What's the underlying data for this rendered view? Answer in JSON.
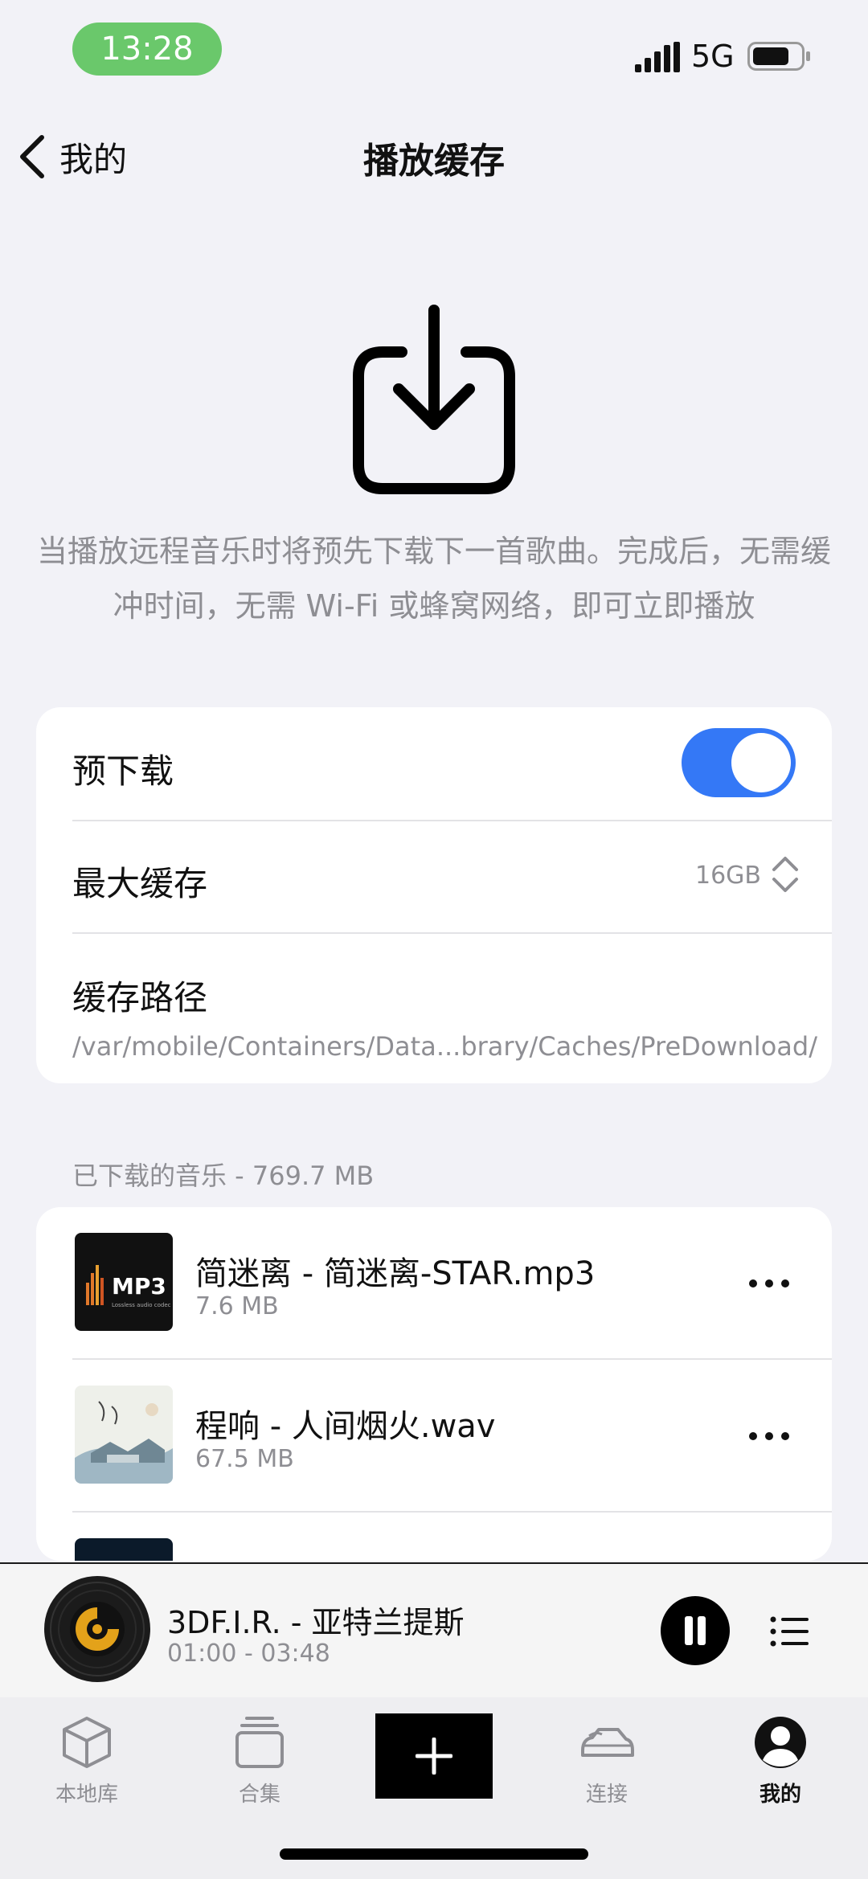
{
  "status_bar": {
    "time": "13:28",
    "network": "5G"
  },
  "nav": {
    "back_label": "我的",
    "title": "播放缓存"
  },
  "hero": {
    "icon": "download-tray-icon",
    "description": "当播放远程音乐时将预先下载下一首歌曲。完成后，无需缓冲时间，无需 Wi-Fi 或蜂窝网络，即可立即播放"
  },
  "settings": {
    "predownload_label": "预下载",
    "predownload_enabled": true,
    "max_cache_label": "最大缓存",
    "max_cache_value": "16GB",
    "cache_path_label": "缓存路径",
    "cache_path_value": "/var/mobile/Containers/Data...brary/Caches/PreDownload/"
  },
  "downloaded": {
    "header": "已下载的音乐 - 769.7 MB",
    "tracks": [
      {
        "title": "简迷离 - 简迷离-STAR.mp3",
        "size": "7.6 MB"
      },
      {
        "title": "程响 - 人间烟火.wav",
        "size": "67.5 MB"
      }
    ]
  },
  "player": {
    "title": "3DF.I.R. - 亚特兰提斯",
    "time": "01:00 - 03:48"
  },
  "tabs": [
    {
      "label": "本地库"
    },
    {
      "label": "合集"
    },
    {
      "label": "连接"
    },
    {
      "label": "我的"
    }
  ],
  "colors": {
    "accent": "#3478f6",
    "status_pill": "#6ac86b",
    "background": "#f2f2f7"
  }
}
